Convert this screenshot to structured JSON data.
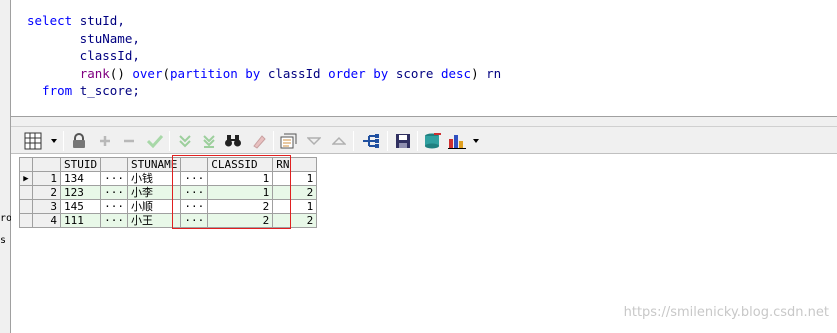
{
  "editor": {
    "lines": [
      [
        {
          "t": "select ",
          "c": "kw"
        },
        {
          "t": "stuId,",
          "c": "id"
        }
      ],
      [
        {
          "t": "       stuName,",
          "c": "id"
        }
      ],
      [
        {
          "t": "       classId,",
          "c": "id"
        }
      ],
      [
        {
          "t": "       ",
          "c": "txt"
        },
        {
          "t": "rank",
          "c": "fn"
        },
        {
          "t": "() ",
          "c": "txt"
        },
        {
          "t": "over",
          "c": "kw"
        },
        {
          "t": "(",
          "c": "txt"
        },
        {
          "t": "partition by ",
          "c": "kw"
        },
        {
          "t": "classId ",
          "c": "id"
        },
        {
          "t": "order by ",
          "c": "kw"
        },
        {
          "t": "score ",
          "c": "id"
        },
        {
          "t": "desc",
          "c": "kw"
        },
        {
          "t": ") ",
          "c": "txt"
        },
        {
          "t": "rn",
          "c": "id"
        }
      ],
      [
        {
          "t": "  from ",
          "c": "kw"
        },
        {
          "t": "t_score;",
          "c": "id"
        }
      ]
    ]
  },
  "gutter": {
    "label1": "ro",
    "label2": "s"
  },
  "toolbar": {
    "icons": [
      "grid-menu-icon",
      "lock-icon",
      "add-record-icon",
      "delete-record-icon",
      "post-changes-icon",
      "fetch-next-page-icon",
      "fetch-last-page-icon",
      "find-icon",
      "clear-icon",
      "query-by-example-icon",
      "previous-icon",
      "next-icon",
      "single-record-view-icon",
      "save-icon",
      "export-icon",
      "chart-icon"
    ]
  },
  "grid": {
    "columns": [
      "STUID",
      "STUNAME",
      "CLASSID",
      "RN"
    ],
    "rows": [
      {
        "n": "1",
        "stuid": "134",
        "stuname": "小钱",
        "classid": "1",
        "rn": "1"
      },
      {
        "n": "2",
        "stuid": "123",
        "stuname": "小李",
        "classid": "1",
        "rn": "2"
      },
      {
        "n": "3",
        "stuid": "145",
        "stuname": "小顺",
        "classid": "2",
        "rn": "1"
      },
      {
        "n": "4",
        "stuid": "111",
        "stuname": "小王",
        "classid": "2",
        "rn": "2"
      }
    ],
    "ellipsis": "···",
    "current_row_indicator": "▶"
  },
  "watermark": "https://smilenicky.blog.csdn.net",
  "colors": {
    "keyword": "#0000ff",
    "function": "#800080",
    "identifier": "#000080",
    "even_row": "#e8f8e8",
    "highlight_box": "#e02020"
  }
}
